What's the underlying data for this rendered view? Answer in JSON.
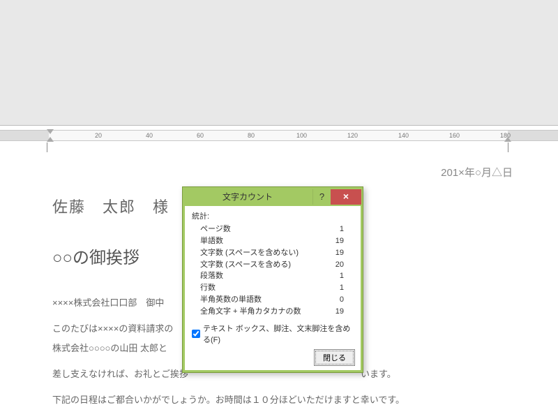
{
  "ruler": {
    "ticks": [
      "20",
      "40",
      "60",
      "80",
      "100",
      "120",
      "140",
      "160",
      "180"
    ]
  },
  "document": {
    "date": "201×年○月△日",
    "recipient": "佐藤　太郎　様",
    "title": "○○の御挨拶",
    "body1": "××××株式会社口口部　御中",
    "body2": "このたびは××××の資料請求の",
    "body3": "株式会社○○○○の山田 太郎と",
    "body4": "差し支えなければ、お礼とご挨拶　　　　　　　　　　　　　　　　　　　います。",
    "body5": "下記の日程はご都合いかがでしょうか。お時間は１０分ほどいただけますと幸いです。"
  },
  "dialog": {
    "title": "文字カウント",
    "help": "?",
    "close_x": "×",
    "stats_header": "統計:",
    "rows": [
      {
        "label": "ページ数",
        "value": "1"
      },
      {
        "label": "単語数",
        "value": "19"
      },
      {
        "label": "文字数 (スペースを含めない)",
        "value": "19"
      },
      {
        "label": "文字数 (スペースを含める)",
        "value": "20"
      },
      {
        "label": "段落数",
        "value": "1"
      },
      {
        "label": "行数",
        "value": "1"
      },
      {
        "label": "半角英数の単語数",
        "value": "0"
      },
      {
        "label": "全角文字 + 半角カタカナの数",
        "value": "19"
      }
    ],
    "checkbox_label": "テキスト ボックス、脚注、文末脚注を含める(F)",
    "close_button": "閉じる"
  }
}
